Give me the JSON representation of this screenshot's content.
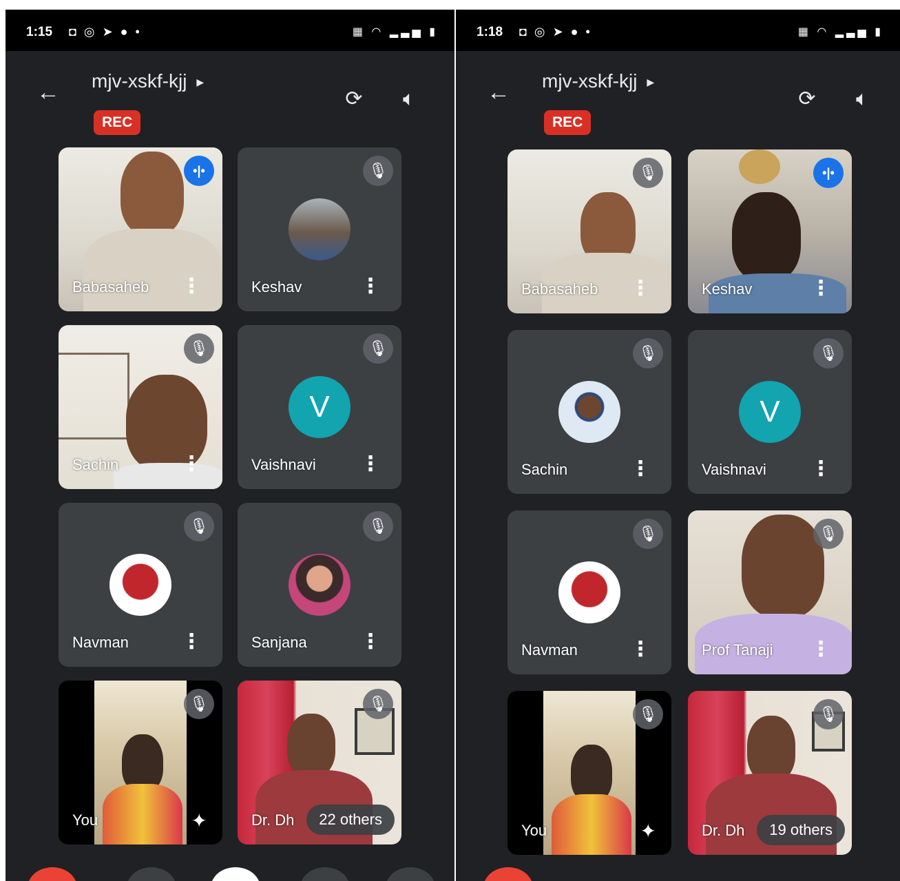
{
  "screens": [
    {
      "status_time": "1:15",
      "meeting_code": "mjv-xskf-kjj",
      "rec_label": "REC",
      "tiles": [
        "Babasaheb",
        "Keshav",
        "Sachin",
        "Vaishnavi",
        "Navman",
        "Sanjana",
        "You",
        "Dr. Dh"
      ],
      "vaishnavi_initial": "V",
      "others_label": "22 others"
    },
    {
      "status_time": "1:18",
      "meeting_code": "mjv-xskf-kjj",
      "rec_label": "REC",
      "tiles": [
        "Babasaheb",
        "Keshav",
        "Sachin",
        "Vaishnavi",
        "Navman",
        "Prof Tanaji",
        "You",
        "Dr. Dh"
      ],
      "vaishnavi_initial": "V",
      "others_label": "19 others"
    }
  ],
  "icons": {
    "back": "back-arrow-icon",
    "camera_switch": "switch-camera-icon",
    "speaker": "speaker-icon",
    "mic_off": "mic-off-icon",
    "more": "more-vert-icon",
    "speaking": "speaking-indicator-icon",
    "effects": "sparkle-effects-icon"
  },
  "colors": {
    "background": "#202124",
    "tile": "#3c4043",
    "rec": "#d93025",
    "avatar_teal": "#12a4af",
    "speaking_blue": "#1a73e8"
  }
}
